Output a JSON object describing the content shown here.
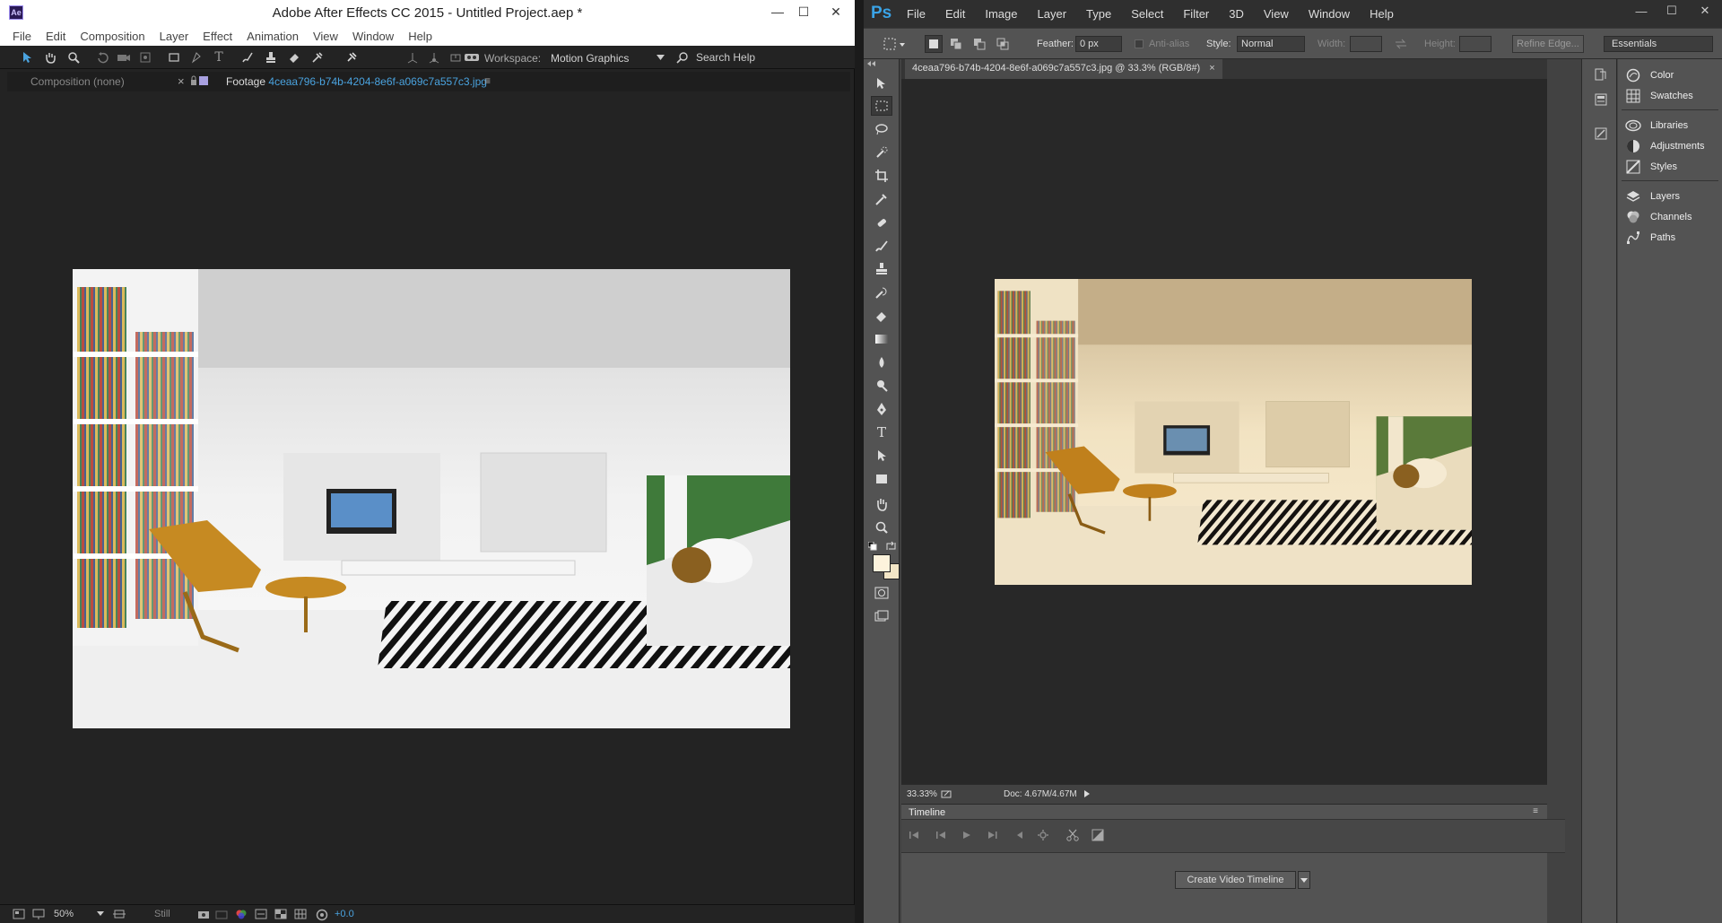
{
  "after_effects": {
    "logo": "Ae",
    "title": "Adobe After Effects CC 2015 - Untitled Project.aep *",
    "menu": [
      "File",
      "Edit",
      "Composition",
      "Layer",
      "Effect",
      "Animation",
      "View",
      "Window",
      "Help"
    ],
    "toolbar": {
      "workspace_label": "Workspace:",
      "workspace_value": "Motion Graphics",
      "search_placeholder": "Search Help"
    },
    "tabs": {
      "composition": "Composition (none)",
      "footage_prefix": "Footage",
      "footage_name": "4ceaa796-b74b-4204-8e6f-a069c7a557c3.jpg"
    },
    "status": {
      "zoom": "50%",
      "mode": "Still",
      "exposure": "+0.0"
    }
  },
  "photoshop": {
    "logo": "Ps",
    "menu": [
      "File",
      "Edit",
      "Image",
      "Layer",
      "Type",
      "Select",
      "Filter",
      "3D",
      "View",
      "Window",
      "Help"
    ],
    "options": {
      "feather_label": "Feather:",
      "feather_value": "0 px",
      "anti_alias_label": "Anti-alias",
      "style_label": "Style:",
      "style_value": "Normal",
      "width_label": "Width:",
      "height_label": "Height:",
      "refine_edge": "Refine Edge...",
      "workspace": "Essentials"
    },
    "document_tab": "4ceaa796-b74b-4204-8e6f-a069c7a557c3.jpg @ 33.3% (RGB/8#)",
    "status": {
      "zoom": "33.33%",
      "doc_size": "Doc: 4.67M/4.67M"
    },
    "timeline": {
      "title": "Timeline",
      "create_button": "Create Video Timeline"
    },
    "panels": [
      "Color",
      "Swatches",
      "Libraries",
      "Adjustments",
      "Styles",
      "Layers",
      "Channels",
      "Paths"
    ],
    "colors": {
      "foreground": "#fdf3dc",
      "background": "#f3e6c6"
    }
  }
}
